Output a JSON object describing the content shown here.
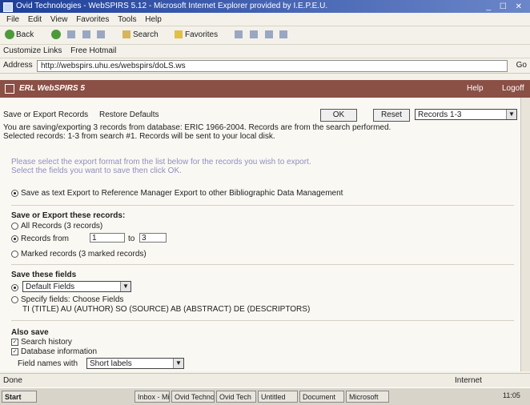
{
  "window": {
    "title": "Ovid Technologies - WebSPIRS 5.12 - Microsoft Internet Explorer provided by I.E.P.E.U.",
    "controls": "_ ☐ ✕"
  },
  "menu": [
    "File",
    "Edit",
    "View",
    "Favorites",
    "Tools",
    "Help"
  ],
  "toolbar": {
    "back": "Back",
    "search": "Search",
    "favorites": "Favorites"
  },
  "links": {
    "customize": "Customize Links",
    "free_hotmail": "Free Hotmail"
  },
  "address": {
    "label": "Address",
    "value": "http://webspirs.uhu.es/webspirs/doLS.ws",
    "go": "Go"
  },
  "banner": {
    "app_name": "ERL WebSPIRS 5",
    "help": "Help",
    "logoff": "Logoff"
  },
  "export": {
    "heading": "Save or Export Records",
    "restore": "Restore Defaults",
    "ok": "OK",
    "reset": "Reset",
    "format": "Records 1-3",
    "desc_line1": "You are saving/exporting 3 records from database: ERIC 1966-2004. Records are from the search performed.",
    "desc_line2": "Selected records: 1-3 from search #1. Records will be sent to your local disk.",
    "hint_line1": "Please select the export format from the list below for the records you wish to export.",
    "hint_line2": "Select the fields you want to save then click OK.",
    "format_options": "Save as text   Export to Reference Manager   Export to other Bibliographic Data Management",
    "records_heading": "Save or Export these records:",
    "all_records": "All Records (3 records)",
    "records_from": "Records from",
    "from_value": "1",
    "to_label": "to",
    "to_value": "3",
    "marked_records": "Marked records (3 marked records)",
    "fields_heading": "Save these fields",
    "default_fields": "Default Fields",
    "specify_fields": "Specify fields: Choose Fields",
    "fields_list": "TI (TITLE) AU (AUTHOR) SO (SOURCE) AB (ABSTRACT) DE (DESCRIPTORS)",
    "also_heading": "Also save",
    "search_history": "Search history",
    "database_info": "Database information",
    "field_names_label": "Field names with",
    "field_names_value": "Short labels"
  },
  "status": {
    "left": "Done",
    "zone": "Internet"
  },
  "taskbar": {
    "start": "Start",
    "tasks": [
      "Inbox - Microsoft",
      "Ovid Technol",
      "Ovid Tech",
      "Untitled",
      "Document",
      "Microsoft"
    ],
    "clock": "11:05"
  }
}
